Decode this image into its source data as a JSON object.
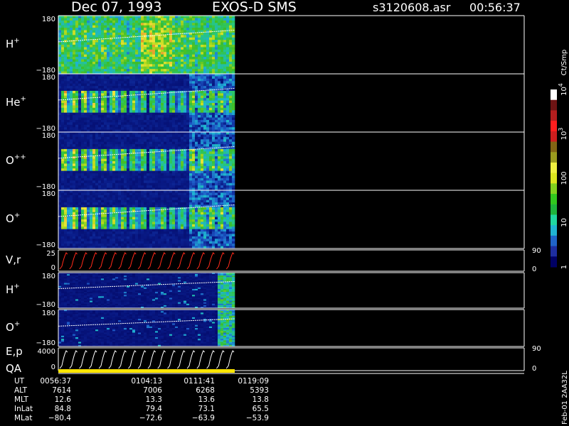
{
  "header": {
    "date": "Dec 07, 1993",
    "instrument": "EXOS-D SMS",
    "file": "s3120608.asr",
    "time": "00:56:37"
  },
  "colors": {
    "background": "#000000",
    "frame": "#ffffff",
    "pitch_line": "#ffffff",
    "vr_trace": "#ff2a1a",
    "ep_trace": "#ffffff",
    "qa_bar": "#ffe600"
  },
  "chart_data": [
    {
      "type": "heatmap",
      "panel": "H+",
      "label": "H",
      "label_sup": "+",
      "y_ticks": [
        "180",
        "−180"
      ],
      "ylim": [
        -180,
        180
      ],
      "x_range": [
        "0056:37",
        "0119:09"
      ]
    },
    {
      "type": "heatmap",
      "panel": "He+",
      "label": "He",
      "label_sup": "+",
      "y_ticks": [
        "180",
        "−180"
      ],
      "ylim": [
        -180,
        180
      ]
    },
    {
      "type": "heatmap",
      "panel": "O++",
      "label": "O",
      "label_sup": "++",
      "y_ticks": [
        "180",
        "−180"
      ],
      "ylim": [
        -180,
        180
      ]
    },
    {
      "type": "heatmap",
      "panel": "O+",
      "label": "O",
      "label_sup": "+",
      "y_ticks": [
        "180",
        "−180"
      ],
      "ylim": [
        -180,
        180
      ]
    },
    {
      "type": "line",
      "panel": "V,r",
      "label": "V,r",
      "y_ticks": [
        "25",
        "0"
      ],
      "ylim": [
        0,
        25
      ],
      "right_ticks": [
        "90",
        "0"
      ],
      "right_lim": [
        0,
        90
      ],
      "cycles": 18
    },
    {
      "type": "heatmap",
      "panel": "H+ (low)",
      "label": "H",
      "label_sup": "+",
      "y_ticks": [
        "180",
        "−180"
      ],
      "ylim": [
        -180,
        180
      ]
    },
    {
      "type": "heatmap",
      "panel": "O+ (low)",
      "label": "O",
      "label_sup": "+",
      "y_ticks": [
        "180",
        "−180"
      ],
      "ylim": [
        -180,
        180
      ]
    },
    {
      "type": "line",
      "panel": "E,p",
      "label": "E,p",
      "y_ticks": [
        "4000",
        "0"
      ],
      "ylim": [
        0,
        4000
      ],
      "right_ticks": [
        "90",
        "0"
      ],
      "right_lim": [
        0,
        90
      ],
      "cycles": 18
    },
    {
      "type": "bar",
      "panel": "QA",
      "label": "QA"
    },
    {
      "type": "table",
      "panel": "orbit",
      "rows": [
        {
          "name": "UT",
          "values": [
            "0056:37",
            "0104:13",
            "0111:41",
            "0119:09"
          ]
        },
        {
          "name": "ALT",
          "values": [
            "7614",
            "7006",
            "6268",
            "5393"
          ]
        },
        {
          "name": "MLT",
          "values": [
            "12.6",
            "13.3",
            "13.6",
            "13.8"
          ]
        },
        {
          "name": "InLat",
          "values": [
            "84.8",
            "79.4",
            "73.1",
            "65.5"
          ]
        },
        {
          "name": "MLat",
          "values": [
            "−80.4",
            "−72.6",
            "−63.9",
            "−53.9"
          ]
        }
      ]
    },
    {
      "type": "heatmap",
      "panel": "colorbar",
      "unit": "Ct/Smp",
      "scale": "log",
      "range": [
        1,
        10000
      ],
      "tick_labels": [
        {
          "text": "1",
          "value": 1
        },
        {
          "text": "10",
          "value": 10
        },
        {
          "text": "100",
          "value": 100
        },
        {
          "text": "10",
          "sup": "3",
          "value": 1000
        },
        {
          "text": "10",
          "sup": "4",
          "value": 10000
        }
      ],
      "colors": [
        "#000064",
        "#1e2ea0",
        "#2064c8",
        "#20b4d2",
        "#20d7a0",
        "#1eb43c",
        "#32c81e",
        "#82d21e",
        "#dce61e",
        "#f0f040",
        "#9b9b1e",
        "#826414",
        "#cc1e1e",
        "#ff1e1e",
        "#b41e1e",
        "#6e1414",
        "#ffffff"
      ]
    }
  ],
  "footer": {
    "rotated_text": "Feb-01 2AA32L"
  }
}
